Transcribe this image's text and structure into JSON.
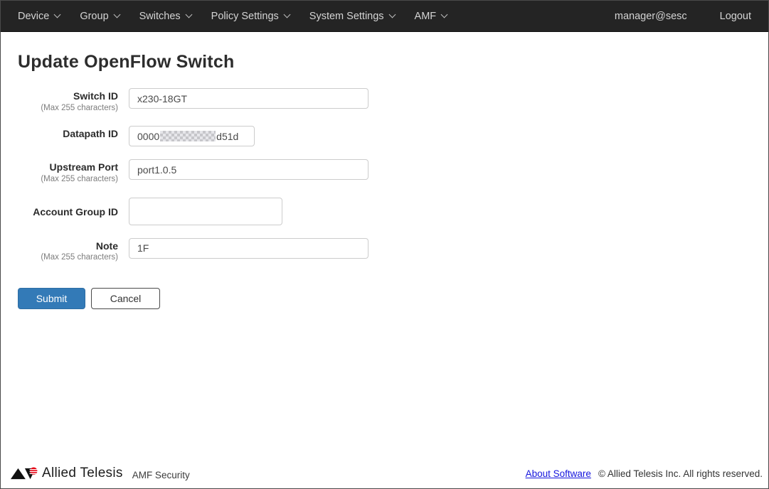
{
  "nav": {
    "items": [
      {
        "label": "Device"
      },
      {
        "label": "Group"
      },
      {
        "label": "Switches"
      },
      {
        "label": "Policy Settings"
      },
      {
        "label": "System Settings"
      },
      {
        "label": "AMF"
      }
    ],
    "user": "manager@sesc",
    "logout_label": "Logout"
  },
  "page": {
    "title": "Update OpenFlow Switch"
  },
  "form": {
    "switch_id": {
      "label": "Switch ID",
      "hint": "(Max 255 characters)",
      "value": "x230-18GT"
    },
    "datapath_id": {
      "label": "Datapath ID",
      "value_prefix": "0000",
      "value_suffix": "d51d",
      "redacted": "middle portion pixelated"
    },
    "upstream_port": {
      "label": "Upstream Port",
      "hint": "(Max 255 characters)",
      "value": "port1.0.5"
    },
    "account_group_id": {
      "label": "Account Group ID",
      "value": ""
    },
    "note": {
      "label": "Note",
      "hint": "(Max 255 characters)",
      "value": "1F"
    }
  },
  "buttons": {
    "submit": "Submit",
    "cancel": "Cancel"
  },
  "footer": {
    "brand": "Allied Telesis",
    "product": "AMF Security",
    "about_link": "About Software",
    "copyright": "© Allied Telesis Inc. All rights reserved."
  },
  "colors": {
    "navbar_bg": "#242424",
    "accent_blue": "#337ab7",
    "link_blue": "#1414dd",
    "logo_red": "#e60012"
  }
}
